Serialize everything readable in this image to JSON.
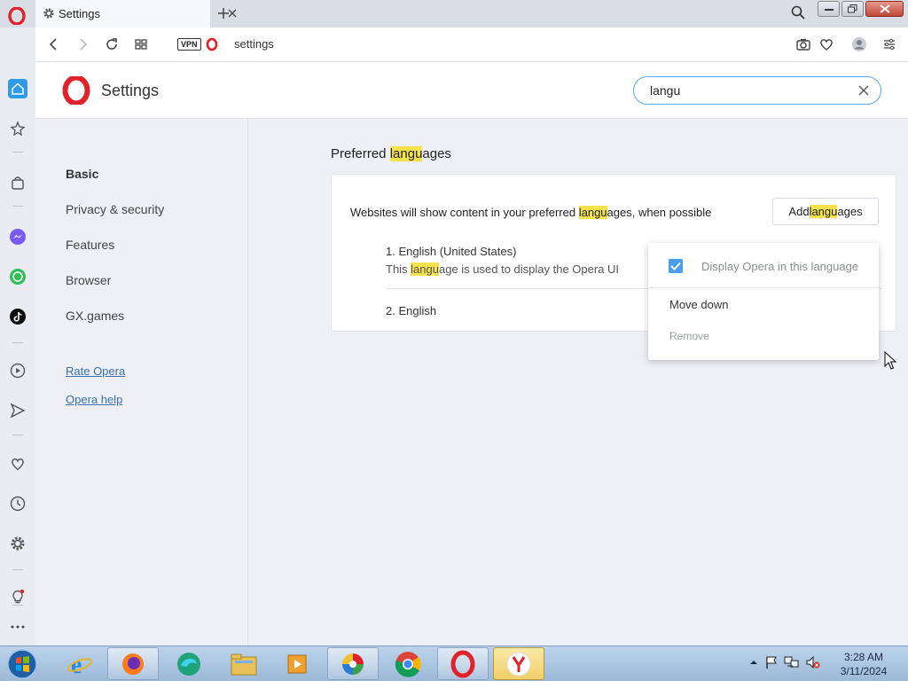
{
  "browser": {
    "tab_title": "Settings",
    "url": "settings",
    "vpn_label": "VPN"
  },
  "settings": {
    "header_title": "Settings",
    "search_value": "langu",
    "nav": {
      "items": [
        "Basic",
        "Privacy & security",
        "Features",
        "Browser",
        "GX.games"
      ],
      "active": "Basic",
      "links": [
        "Rate Opera",
        "Opera help"
      ]
    },
    "section": {
      "title_pre": "Preferred ",
      "title_hl": "langu",
      "title_post": "ages",
      "desc_pre": "Websites will show content in your preferred ",
      "desc_hl": "langu",
      "desc_post": "ages, when possible",
      "add_pre": "Add ",
      "add_hl": "langu",
      "add_post": "ages",
      "languages": [
        {
          "label": "1. English (United States)",
          "note_pre": "This ",
          "note_hl": "langu",
          "note_post": "age is used to display the Opera UI"
        },
        {
          "label": "2. English"
        }
      ]
    },
    "context_menu": {
      "display_in_language": "Display Opera in this language",
      "display_checked": true,
      "move_down": "Move down",
      "remove": "Remove"
    }
  },
  "taskbar": {
    "apps": [
      "internet-explorer",
      "firefox",
      "edge-chromium",
      "file-explorer",
      "media-player",
      "picasa",
      "chrome",
      "opera",
      "yandex"
    ],
    "clock_time": "3:28 AM",
    "clock_date": "3/11/2024"
  },
  "colors": {
    "highlight": "#f6e24b",
    "accent_blue": "#4a9fe8",
    "opera_red": "#e0222a"
  }
}
